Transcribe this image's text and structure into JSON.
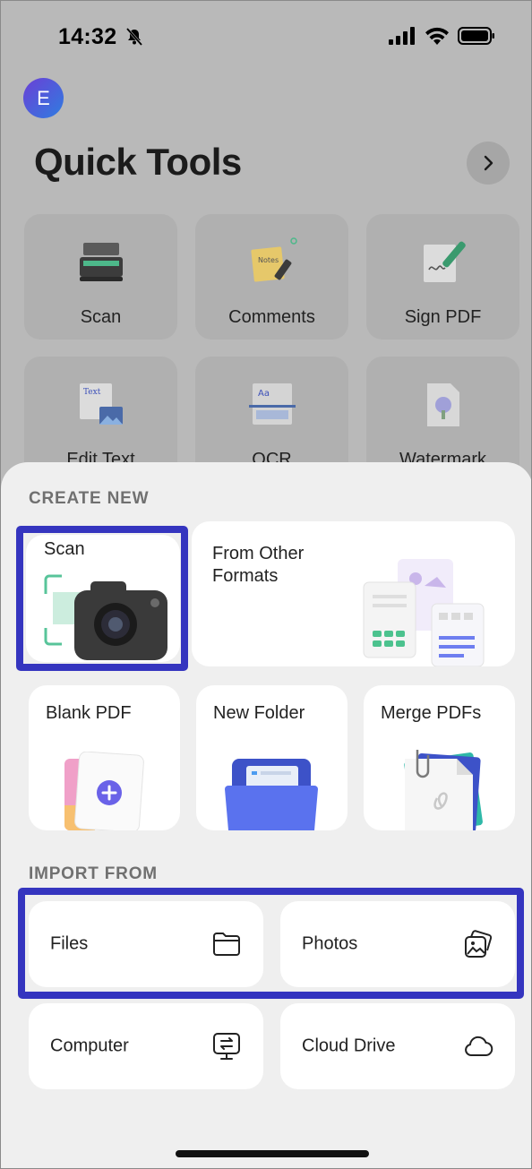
{
  "status": {
    "time": "14:32"
  },
  "avatar_letter": "E",
  "page_title": "Quick Tools",
  "quick_tools": [
    {
      "label": "Scan",
      "icon": "scanner-icon"
    },
    {
      "label": "Comments",
      "icon": "notes-icon"
    },
    {
      "label": "Sign PDF",
      "icon": "signature-icon"
    },
    {
      "label": "Edit Text",
      "icon": "edit-text-icon"
    },
    {
      "label": "OCR",
      "icon": "ocr-icon"
    },
    {
      "label": "Watermark",
      "icon": "watermark-icon"
    }
  ],
  "create_new": {
    "section_label": "CREATE NEW",
    "scan": "Scan",
    "other_formats": "From Other Formats",
    "blank_pdf": "Blank PDF",
    "new_folder": "New Folder",
    "merge_pdfs": "Merge PDFs"
  },
  "import_from": {
    "section_label": "IMPORT FROM",
    "files": "Files",
    "photos": "Photos",
    "computer": "Computer",
    "cloud_drive": "Cloud Drive"
  },
  "colors": {
    "highlight": "#3535bf",
    "accent": "#5b5be6"
  }
}
